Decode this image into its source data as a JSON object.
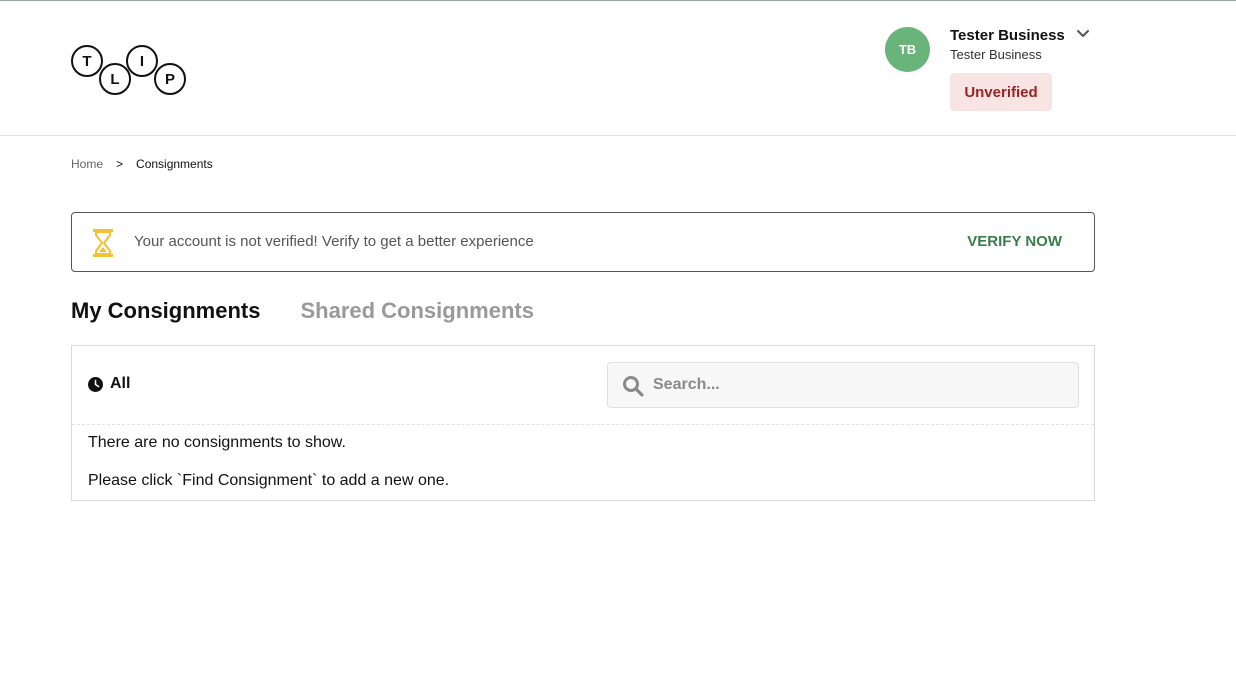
{
  "logo": {
    "letters": [
      "T",
      "L",
      "I",
      "P"
    ]
  },
  "user": {
    "initials": "TB",
    "name": "Tester Business",
    "subtitle": "Tester Business",
    "status": "Unverified",
    "avatar_color": "#69b47b",
    "status_bg": "#f9e4e4",
    "status_color": "#9b2326"
  },
  "breadcrumb": {
    "home": "Home",
    "separator": ">",
    "current": "Consignments"
  },
  "notice": {
    "icon": "hourglass-icon",
    "message": "Your account is not verified! Verify to get a better experience",
    "action": "VERIFY NOW",
    "action_color": "#3a7d4c"
  },
  "tabs": [
    {
      "label": "My Consignments",
      "active": true
    },
    {
      "label": "Shared Consignments",
      "active": false
    }
  ],
  "filter": {
    "icon": "clock-icon",
    "label": "All"
  },
  "search": {
    "placeholder": "Search...",
    "value": ""
  },
  "empty_state": {
    "line1": "There are no consignments to show.",
    "line2": "Please click `Find Consignment` to add a new one."
  }
}
